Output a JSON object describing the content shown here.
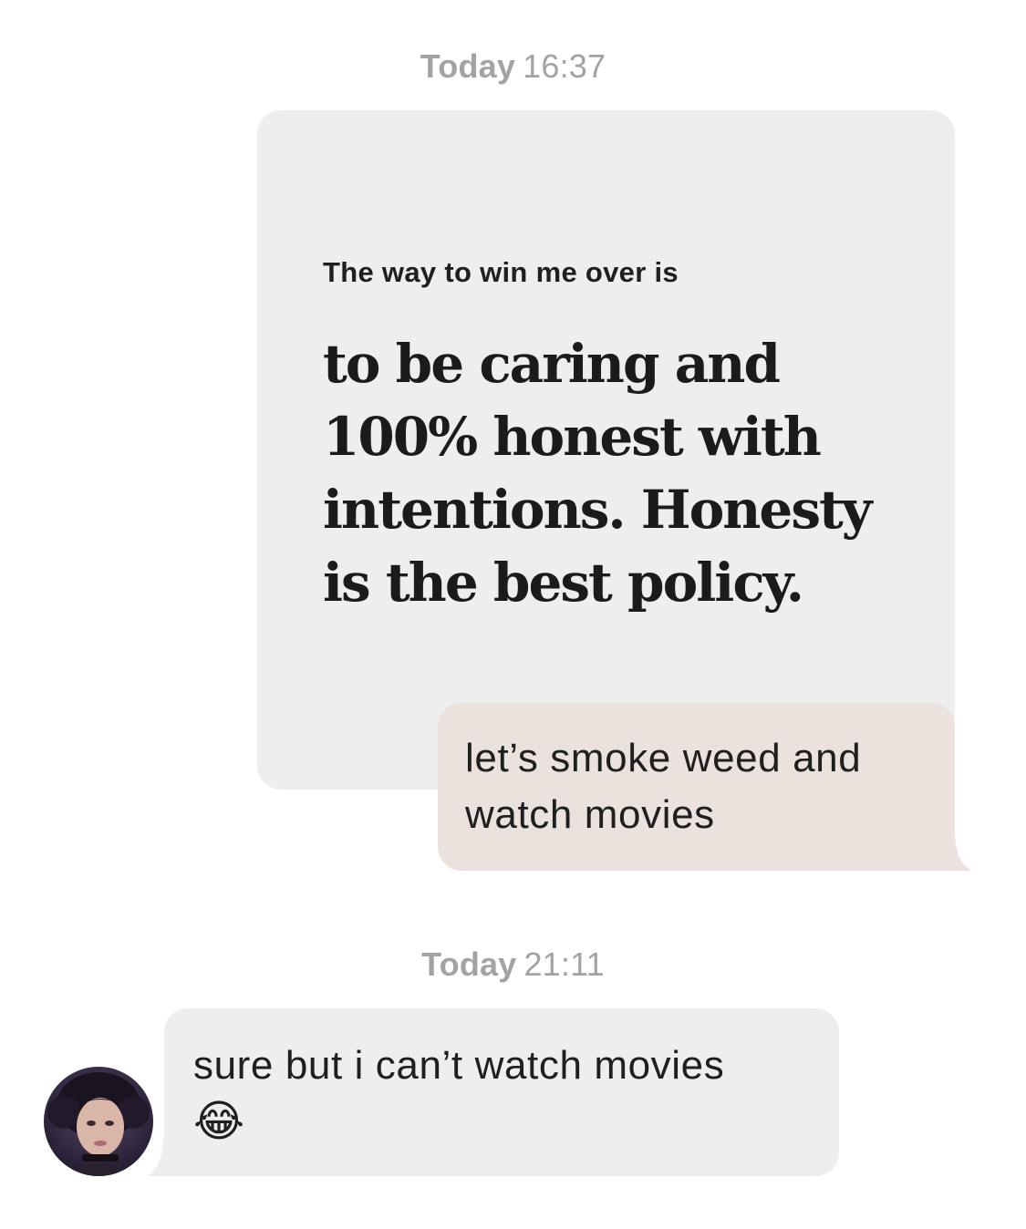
{
  "conversation": {
    "timestamps": [
      {
        "day": "Today",
        "time": "16:37"
      },
      {
        "day": "Today",
        "time": "21:11"
      }
    ],
    "prompt": {
      "question": "The way to win me over is",
      "answer": "to be caring and 100% honest with intentions. Honesty is the best policy."
    },
    "outgoing_message": {
      "text": "let’s smoke weed and watch movies"
    },
    "incoming_message": {
      "text": "sure but i can’t watch movies",
      "emoji": "😂"
    },
    "avatar": {
      "icon": "profile-photo-avatar"
    }
  },
  "colors": {
    "background": "#ffffff",
    "prompt_card": "#eeeeee",
    "outgoing_bubble": "#ebe2dd",
    "incoming_bubble": "#eeeeee",
    "timestamp_text": "#a3a3a3",
    "body_text": "#1f1f1f"
  }
}
